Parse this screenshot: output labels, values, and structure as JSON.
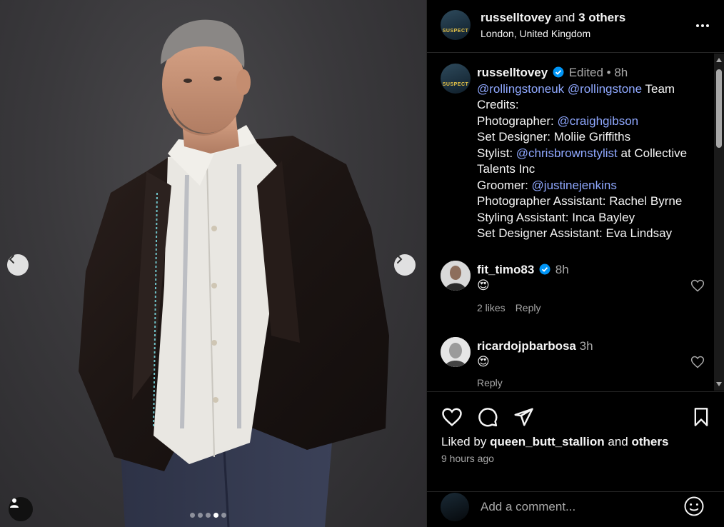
{
  "header": {
    "username": "russelltovey",
    "and_text": "and",
    "others_text": "3 others",
    "location": "London, United Kingdom",
    "avatar_text": "SUSPECT"
  },
  "caption": {
    "username": "russelltovey",
    "edited": "Edited",
    "separator": "•",
    "time": "8h",
    "lines": {
      "mention1": "@rollingstoneuk",
      "mention2": "@rollingstone",
      "team_credits": "Team Credits:",
      "photographer_label": "Photographer:",
      "photographer": "@craighgibson",
      "set_designer": "Set Designer: Moliie Griffiths",
      "stylist_label": "Stylist:",
      "stylist": "@chrisbrownstylist",
      "stylist_suffix": "at Collective Talents Inc",
      "groomer_label": "Groomer:",
      "groomer": "@justinejenkins",
      "photographer_assistant": "Photographer Assistant: Rachel Byrne",
      "styling_assistant": "Styling Assistant: Inca Bayley",
      "set_designer_assistant": "Set Designer Assistant: Eva Lindsay"
    }
  },
  "comments": [
    {
      "username": "fit_timo83",
      "verified": true,
      "time": "8h",
      "text": "😍",
      "likes": "2 likes",
      "reply": "Reply"
    },
    {
      "username": "ricardojpbarbosa",
      "verified": false,
      "time": "3h",
      "text": "😍",
      "reply": "Reply"
    }
  ],
  "actions": {
    "liked_by_prefix": "Liked by",
    "liked_by_user": "queen_butt_stallion",
    "liked_by_and": "and",
    "liked_by_others": "others",
    "time_ago": "9 hours ago"
  },
  "composer": {
    "placeholder": "Add a comment..."
  },
  "carousel": {
    "count": 5,
    "active_index": 3
  },
  "colors": {
    "link": "#8fa8ff",
    "verified": "#0095f6",
    "muted": "#a8a8a8",
    "border": "#262626"
  },
  "icons": [
    "chevron-left-icon",
    "chevron-right-icon",
    "user-tag-icon",
    "more-icon",
    "verified-icon",
    "heart-icon",
    "comment-icon",
    "share-icon",
    "bookmark-icon",
    "emoji-icon"
  ]
}
